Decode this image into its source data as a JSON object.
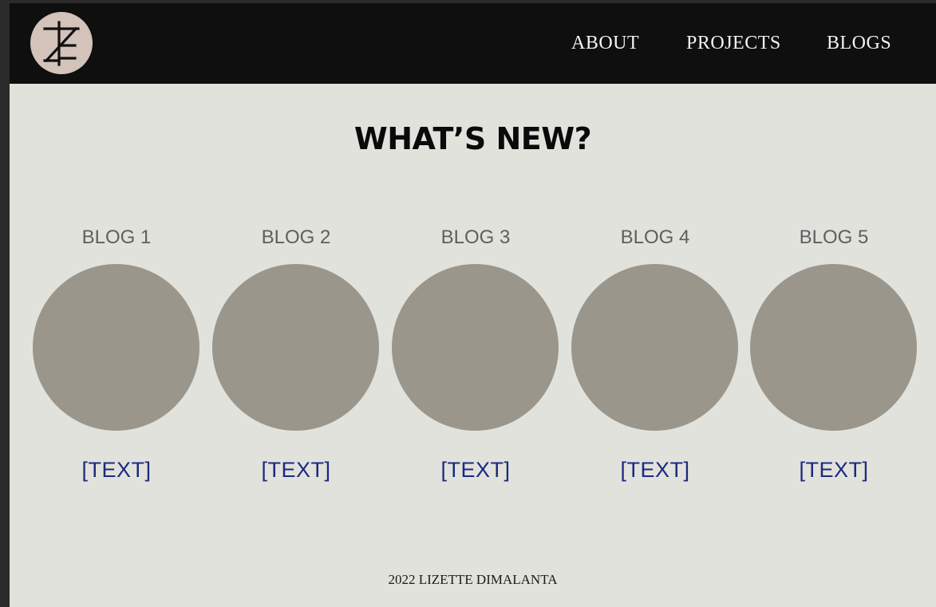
{
  "nav": {
    "logo_icon": "monogram-logo-icon",
    "items": [
      {
        "label": "ABOUT"
      },
      {
        "label": "PROJECTS"
      },
      {
        "label": "BLOGS"
      }
    ]
  },
  "main": {
    "title": "WHAT’S NEW?",
    "blogs": [
      {
        "label": "BLOG 1",
        "text": "[TEXT]"
      },
      {
        "label": "BLOG 2",
        "text": "[TEXT]"
      },
      {
        "label": "BLOG 3",
        "text": "[TEXT]"
      },
      {
        "label": "BLOG 4",
        "text": "[TEXT]"
      },
      {
        "label": "BLOG 5",
        "text": "[TEXT]"
      }
    ]
  },
  "footer": {
    "text": "2022 LIZETTE DIMALANTA"
  },
  "colors": {
    "navbar": "#0f0f0f",
    "page_background": "#e1e2dc",
    "logo_circle": "#d4c3bb",
    "blog_circle": "#9b968c",
    "link_text": "#1b2a80"
  }
}
